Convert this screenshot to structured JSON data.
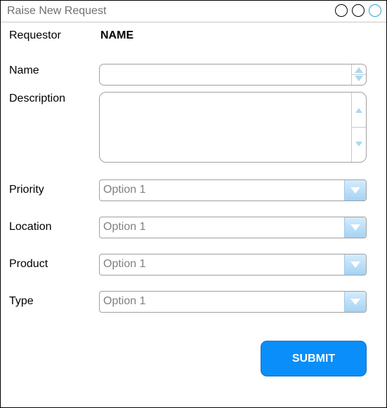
{
  "window": {
    "title": "Raise New Request"
  },
  "form": {
    "requestor_label": "Requestor",
    "requestor_value": "NAME",
    "name_label": "Name",
    "name_value": "",
    "description_label": "Description",
    "description_value": "",
    "priority_label": "Priority",
    "priority_selected": "Option 1",
    "location_label": "Location",
    "location_selected": "Option 1",
    "product_label": "Product",
    "product_selected": "Option 1",
    "type_label": "Type",
    "type_selected": "Option 1",
    "submit_label": "SUBMIT"
  },
  "colors": {
    "accent": "#0a8ef9",
    "dropdown_button": "#a3d3f5",
    "close_button_border": "#29a3d6"
  },
  "icons": {
    "window_buttons": [
      "window-minimize-icon",
      "window-maximize-icon",
      "window-close-icon"
    ],
    "dropdown": "chevron-down-icon",
    "spinner": [
      "arrow-up-icon",
      "arrow-down-icon"
    ]
  }
}
